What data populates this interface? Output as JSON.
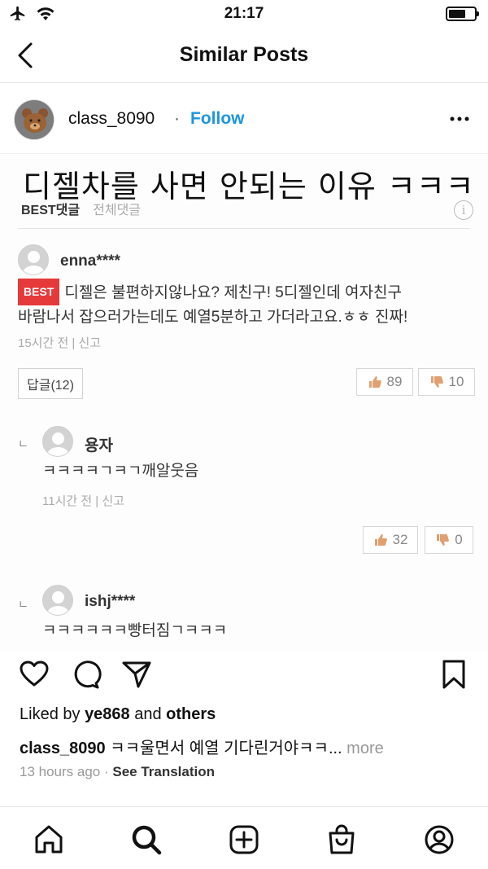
{
  "status_bar": {
    "time": "21:17"
  },
  "header": {
    "title": "Similar Posts"
  },
  "post": {
    "username": "class_8090",
    "separator": "·",
    "follow_label": "Follow"
  },
  "image": {
    "headline": "디젤차를 사면 안되는 이유 ㅋㅋㅋ",
    "tab_best": "BEST댓글",
    "tab_all": "전체댓글",
    "info": "i",
    "comments": [
      {
        "name": "enna****",
        "badge": "BEST",
        "line1": "디젤은 불편하지않나요? 제친구!          5디젤인데 여자친구",
        "line2": "바람나서 잡으러가는데도 예열5분하고 가더라고요.ㅎㅎ 진짜!",
        "meta": "15시간 전  |  신고",
        "reply_label": "답글(12)",
        "up": "89",
        "down": "10"
      },
      {
        "name": "용자",
        "text": "ㅋㅋㅋㅋㄱㅋㄱ깨알웃음",
        "meta": "11시간 전  |  신고",
        "up": "32",
        "down": "0"
      },
      {
        "name": "ishj****",
        "text": "ㅋㅋㅋㅋㅋㅋ빵터짐ㄱㅋㅋㅋ"
      }
    ],
    "reply_marker": "ㄴ"
  },
  "likes": {
    "prefix": "Liked by ",
    "user": "ye868",
    "middle": " and ",
    "others": "others"
  },
  "caption": {
    "user": "class_8090",
    "text": " ㅋㅋ울면서 예열 기다린거야ㅋㅋ... ",
    "more": "more"
  },
  "meta": {
    "time": "13 hours ago",
    "sep": " · ",
    "see_translation": "See Translation"
  },
  "icons": [
    "airplane-icon",
    "wifi-icon",
    "battery-icon",
    "back-chevron-icon",
    "more-icon",
    "heart-icon",
    "comment-icon",
    "share-icon",
    "bookmark-icon",
    "home-icon",
    "search-icon",
    "add-post-icon",
    "shop-icon",
    "profile-icon"
  ]
}
